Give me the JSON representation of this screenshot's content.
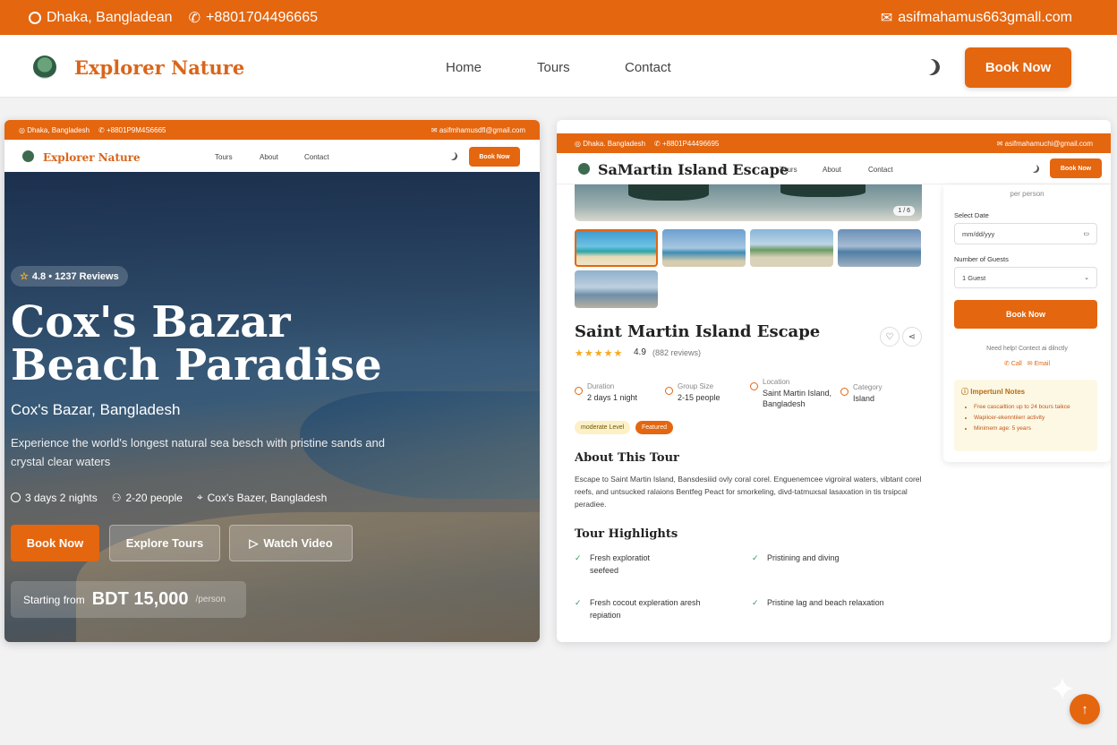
{
  "topbar": {
    "location": "Dhaka, Bangladean",
    "phone": "+8801704496665",
    "email": "asifmahamus663gmall.com"
  },
  "header": {
    "brand": "Explorer Nature",
    "nav": [
      "Home",
      "Tours",
      "Contact"
    ],
    "book_label": "Book Now"
  },
  "left_preview": {
    "mini_topbar": {
      "location": "Dhaka, Bangladesh",
      "phone": "+8801P9M4S6665",
      "email": "asifmhamusdfl@gmail.com"
    },
    "mini_header": {
      "brand": "Explorer Nature",
      "nav": [
        "Tours",
        "About",
        "Contact"
      ],
      "book_label": "Book Now"
    },
    "rating": "4.8 • 1237 Reviews",
    "title": "Cox's Bazar Beach Paradise",
    "location": "Cox's Bazar, Bangladesh",
    "description": "Experience the world's longest natural sea besch with pristine sands and crystal clear waters",
    "meta": [
      "3 days 2 nights",
      "2-20 people",
      "Cox's Bazer, Bangladesh"
    ],
    "buttons": {
      "book": "Book Now",
      "explore": "Explore Tours",
      "video": "Watch Video"
    },
    "price": {
      "prefix": "Starting from",
      "amount": "BDT 15,000",
      "suffix": "/person"
    }
  },
  "right_preview": {
    "mini_topbar": {
      "location": "Dhaka. Bangladesh",
      "phone": "+8801P44496695",
      "email": "asifmahamuchi@gmail.com"
    },
    "mini_header": {
      "title": "SaMartin Island Escape",
      "nav": [
        "Tours",
        "About",
        "Contact"
      ],
      "book_label": "Book Now"
    },
    "gallery_counter": "1 / 6",
    "tour_title": "Saint Martin Island Escape",
    "rating": "4.9",
    "reviews": "(882 reviews)",
    "facts": [
      {
        "label": "Duration",
        "value": "2 days 1 night"
      },
      {
        "label": "Group Size",
        "value": "2-15 people"
      },
      {
        "label": "Location",
        "value": "Saint Martin Island, Bangladesh"
      },
      {
        "label": "Category",
        "value": "Island"
      }
    ],
    "tags": [
      "moderate Level",
      "Featured"
    ],
    "about_heading": "About This Tour",
    "about_text": "Escape to Saint Martin Island, Bansdesiiid ovly coral corel. Enguenemcee vigroiral waters, vibtant corel reefs, and untsucked ralaions Bentfeg Peact for smorkeling, divd-tatmuxsal lasaxation in tis trsipcal peradiee.",
    "highlights_heading": "Tour Highlights",
    "highlights": [
      "Fresh exploratiot seefeed",
      "Pristining and diving",
      "Fresh cocout expleration aresh repiation",
      "Pristine lag and beach relaxation"
    ],
    "booking": {
      "per_person": "per person",
      "date_label": "Select Date",
      "date_placeholder": "mm/dd/yyy",
      "guests_label": "Number of Guests",
      "guests_value": "1 Guest",
      "book_label": "Book Now",
      "help": "Need help! Contect ai dilnctly",
      "call": "Call",
      "email": "Email",
      "notes_title": "Impertunl Notes",
      "notes": [
        "Free cascailtion up to 24 bours taikce",
        "Wapiicer-ekenntiierr activity",
        "Minimem age: 5 years"
      ]
    }
  },
  "colors": {
    "accent": "#e4660f",
    "brand_text": "#d9651a"
  }
}
